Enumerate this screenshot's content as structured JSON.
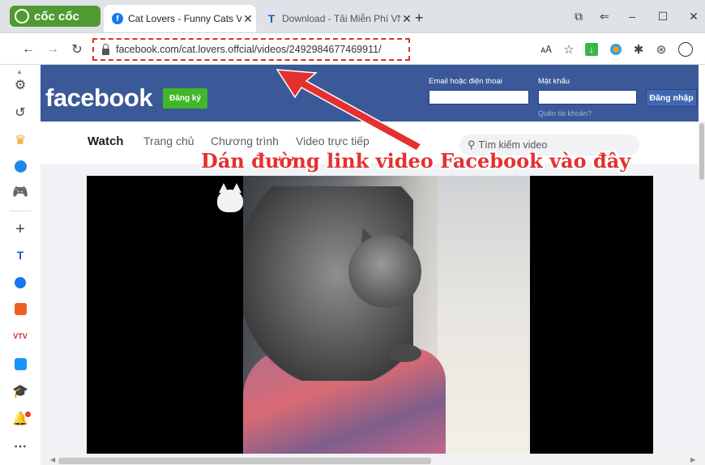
{
  "browser": {
    "brand_label": "cốc cốc",
    "tabs": [
      {
        "label": "Cat Lovers - Funny Cats Vide",
        "active": true
      },
      {
        "label": "Download - Tải Miễn Phí VN",
        "active": false
      }
    ],
    "new_tab_glyph": "+",
    "url": "facebook.com/cat.lovers.offcial/videos/2492984677469911/"
  },
  "facebook": {
    "logo": "facebook",
    "signup_label": "Đăng ký",
    "email_label": "Email hoặc điện thoại",
    "password_label": "Mật khẩu",
    "forgot_label": "Quên tài khoản?",
    "login_label": "Đăng nhập",
    "nav": {
      "watch": "Watch",
      "home": "Trang chủ",
      "programs": "Chương trình",
      "live": "Video trực tiếp"
    },
    "search_placeholder": "Tìm kiếm video"
  },
  "annotation": {
    "text": "Dán đường link video Facebook vào đây",
    "color": "#e53030"
  },
  "colors": {
    "facebook_blue": "#3b5998",
    "coccoc_green": "#4f9a31",
    "signup_green": "#42b72a"
  }
}
